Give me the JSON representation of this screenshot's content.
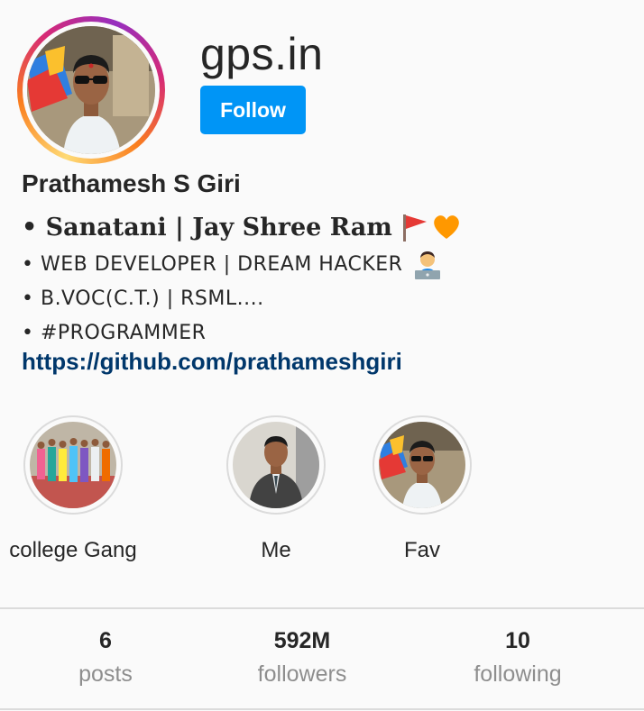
{
  "profile": {
    "username": "gps.in",
    "follow_label": "Follow",
    "full_name": "Prathamesh S Giri",
    "bio": [
      "• Sanatani | Jay Shree Ram",
      "• WEB DEVELOPER | DREAM HACKER",
      "• B.VOC(C.T.) | RSML....",
      "• #PROGRAMMER"
    ],
    "link": "https://github.com/prathameshgiri"
  },
  "highlights": [
    {
      "label": "college Gang"
    },
    {
      "label": "Me"
    },
    {
      "label": "Fav"
    }
  ],
  "stats": [
    {
      "value": "6",
      "label": "posts"
    },
    {
      "value": "592M",
      "label": "followers"
    },
    {
      "value": "10",
      "label": "following"
    }
  ],
  "colors": {
    "follow_button": "#0095f6",
    "link": "#00376b",
    "muted_text": "#8e8e8e",
    "story_ring": [
      "#feda75",
      "#fa7e1e",
      "#d62976",
      "#962fbf"
    ]
  },
  "icons": [
    "flag-emoji-icon",
    "orange-heart-emoji-icon",
    "technologist-emoji-icon"
  ]
}
